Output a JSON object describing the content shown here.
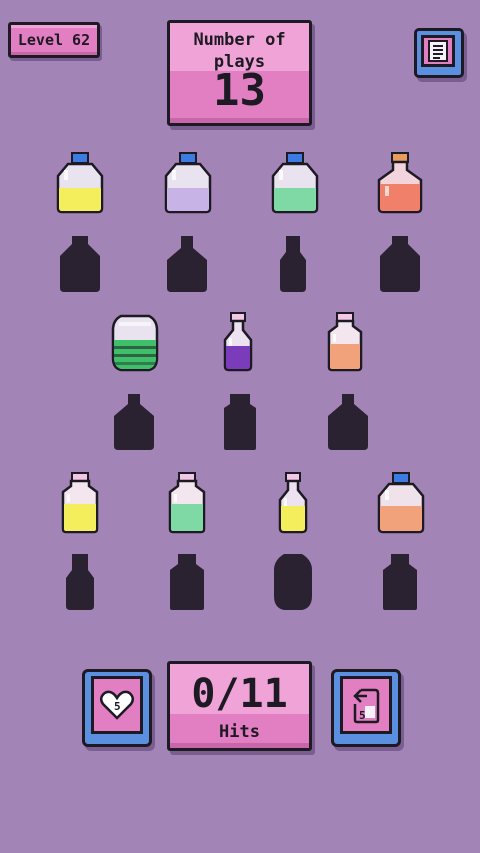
{
  "header": {
    "level_label": "Level 62",
    "plays_label": "Number of plays",
    "plays_count": "13",
    "menu_icon": "list-icon"
  },
  "shelves": [
    {
      "row": 1,
      "bottles": [
        {
          "shape": "jug",
          "liquid_color": "#f4ee5c",
          "cap_color": "#3c7be2"
        },
        {
          "shape": "jug",
          "liquid_color": "#c8b3e6",
          "cap_color": "#3c7be2"
        },
        {
          "shape": "jug",
          "liquid_color": "#7fd9a4",
          "cap_color": "#3c7be2"
        },
        {
          "shape": "flask",
          "liquid_color": "#f0806a",
          "cap_color": "#e89b5c"
        }
      ],
      "silhouettes": [
        "jug",
        "flask",
        "tall-neck",
        "jug"
      ]
    },
    {
      "row": 2,
      "bottles": [
        {
          "shape": "barrel",
          "liquid_color": "#3fbf6a",
          "cap_color": "#3fbf6a"
        },
        {
          "shape": "vial",
          "liquid_color": "#7a3cba",
          "cap_color": "#f2c8e6"
        },
        {
          "shape": "square",
          "liquid_color": "#f2a27a",
          "cap_color": "#f2c8e6"
        }
      ],
      "silhouettes": [
        "round",
        "square",
        "round"
      ]
    },
    {
      "row": 3,
      "bottles": [
        {
          "shape": "square",
          "liquid_color": "#f4ee5c",
          "cap_color": "#f2c8e6"
        },
        {
          "shape": "square",
          "liquid_color": "#7fd9a4",
          "cap_color": "#f2c8e6"
        },
        {
          "shape": "vial",
          "liquid_color": "#f4ee5c",
          "cap_color": "#f2c8e6"
        },
        {
          "shape": "jug",
          "liquid_color": "#f2a27a",
          "cap_color": "#3c7be2"
        }
      ],
      "silhouettes": [
        "tall-neck",
        "square",
        "barrel",
        "square"
      ]
    }
  ],
  "footer": {
    "heart_button_count": "5",
    "hits_count": "0/11",
    "hits_label": "Hits",
    "undo_button_count": "5"
  },
  "colors": {
    "background": "#a384b6",
    "panel_pink": "#e27fc2",
    "button_blue": "#5b8fe0",
    "silhouette": "#2a2230",
    "outline": "#1e1a24"
  }
}
